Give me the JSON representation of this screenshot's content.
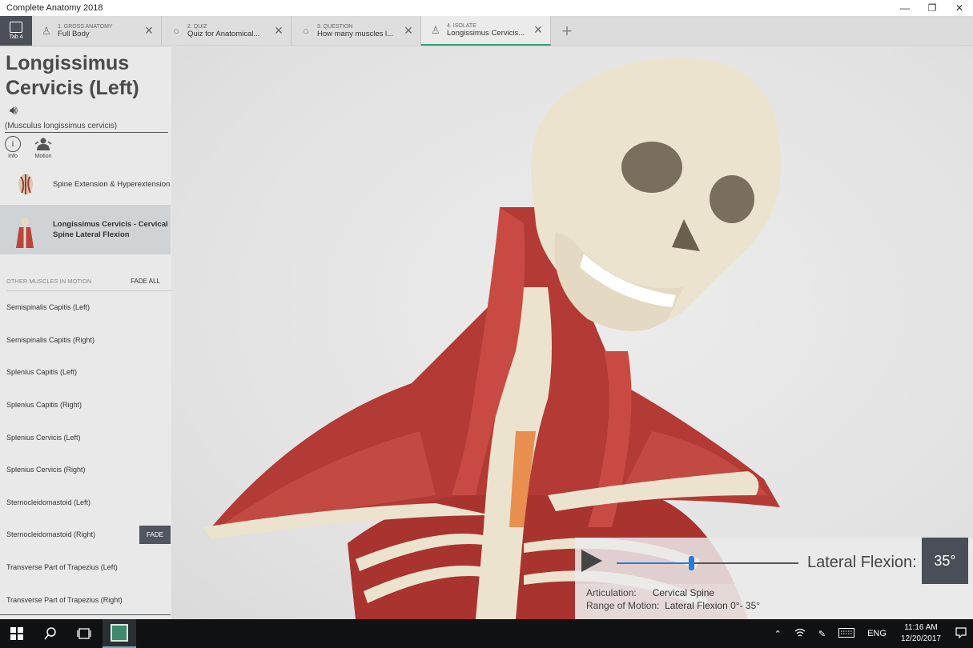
{
  "window": {
    "title": "Complete Anatomy 2018",
    "minimize_glyph": "—",
    "restore_glyph": "❐",
    "close_glyph": "✕"
  },
  "tabs": {
    "home_label": "Tab 4",
    "items": [
      {
        "small": "1. GROSS ANATOMY",
        "main": "Full Body",
        "icon": "person-icon"
      },
      {
        "small": "2. QUIZ",
        "main": "Quiz for Anatomical...",
        "icon": "quiz-icon"
      },
      {
        "small": "3. QUESTION",
        "main": "How many muscles l...",
        "icon": "question-icon"
      },
      {
        "small": "4. ISOLATE",
        "main": "Longissimus Cervicis...",
        "icon": "person-icon"
      }
    ],
    "add_glyph": "+"
  },
  "panel": {
    "title": "Longissimus Cervicis (Left)",
    "latin": "(Musculus longissimus cervicis)",
    "modes": [
      {
        "label": "Info",
        "icon": "info-icon"
      },
      {
        "label": "Motion",
        "icon": "motion-icon"
      }
    ],
    "motions": [
      {
        "label": "Spine Extension & Hyperextension",
        "selected": false
      },
      {
        "label": "Longissimus Cervicis - Cervical Spine Lateral Flexion",
        "selected": true
      }
    ],
    "other_header": "OTHER MUSCLES IN MOTION",
    "fade_all": "FADE ALL",
    "other_muscles": [
      "Semispinalis Capitis (Left)",
      "Semispinalis Capitis (Right)",
      "Splenius Capitis (Left)",
      "Splenius Capitis (Right)",
      "Splenius Cervicis (Left)",
      "Splenius Cervicis (Right)",
      "Sternocleidomastoid (Left)",
      "Sternocleidomastoid (Right)",
      "Transverse Part of Trapezius (Left)",
      "Transverse Part of Trapezius (Right)"
    ],
    "fade_label": "FADE"
  },
  "motion_control": {
    "label": "Lateral Flexion:",
    "value": "35°",
    "progress": 0.41,
    "articulation_key": "Articulation:",
    "articulation_val": "Cervical Spine",
    "rom_key": "Range of Motion:",
    "rom_val": "Lateral Flexion 0°- 35°"
  },
  "taskbar": {
    "lang": "ENG",
    "time": "11:16 AM",
    "date": "12/20/2017"
  },
  "colors": {
    "muscle": "#b33a35",
    "bone": "#ece3cf",
    "accent": "#2b7ad8",
    "tab_active": "#3a9e77"
  }
}
